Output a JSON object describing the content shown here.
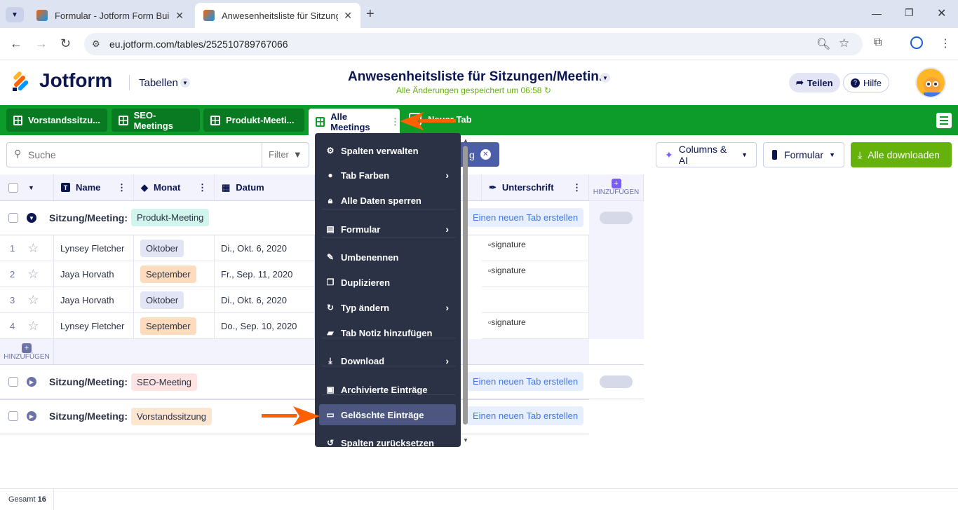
{
  "browser": {
    "tabs": [
      {
        "title": "Formular - Jotform Form Builde",
        "active": false
      },
      {
        "title": "Anwesenheitsliste für Sitzungen",
        "active": true
      }
    ],
    "url": "eu.jotform.com/tables/252510789767066"
  },
  "app": {
    "logo": "Jotform",
    "section": "Tabellen",
    "title": "Anwesenheitsliste für Sitzungen/Meetin...",
    "save_status": "Alle Änderungen gespeichert um 06:58",
    "share_label": "Teilen",
    "help_label": "Hilfe"
  },
  "sheet_tabs": [
    {
      "label": "Vorstandssitzu..."
    },
    {
      "label": "SEO-Meetings"
    },
    {
      "label": "Produkt-Meeti..."
    },
    {
      "label": "Alle Meetings",
      "active": true
    },
    {
      "label": "Neuer Tab"
    }
  ],
  "toolbar": {
    "search_placeholder": "Suche",
    "filter_label": "Filter",
    "chip_label": "g",
    "columns_ai_label": "Columns & AI",
    "form_label": "Formular",
    "download_label": "Alle downloaden"
  },
  "columns": {
    "name": "Name",
    "month": "Monat",
    "date": "Datum",
    "signature": "Unterschrift",
    "add": "HINZUFÜGEN"
  },
  "groups": [
    {
      "label": "Sitzung/Meeting:",
      "tag": "Produkt-Meeting",
      "new_tab": "Einen neuen Tab erstellen"
    },
    {
      "label": "Sitzung/Meeting:",
      "tag": "SEO-Meeting",
      "new_tab": "Einen neuen Tab erstellen"
    },
    {
      "label": "Sitzung/Meeting:",
      "tag": "Vorstandssitzung",
      "new_tab": "Einen neuen Tab erstellen"
    }
  ],
  "rows": [
    {
      "num": "1",
      "name": "Lynsey Fletcher",
      "month": "Oktober",
      "date": "Di., Okt. 6, 2020",
      "signature": "signature"
    },
    {
      "num": "2",
      "name": "Jaya Horvath",
      "month": "September",
      "date": "Fr., Sep. 11, 2020",
      "signature": "signature"
    },
    {
      "num": "3",
      "name": "Jaya Horvath",
      "month": "Oktober",
      "date": "Di., Okt. 6, 2020",
      "signature": ""
    },
    {
      "num": "4",
      "name": "Lynsey Fletcher",
      "month": "September",
      "date": "Do., Sep. 10, 2020",
      "signature": "signature"
    }
  ],
  "add_row_label": "HINZUFÜGEN",
  "menu": {
    "items": [
      {
        "label": "Spalten verwalten",
        "icon": "gear-icon"
      },
      {
        "label": "Tab Farben",
        "icon": "drop-icon",
        "submenu": true
      },
      {
        "label": "Alle Daten sperren",
        "icon": "lock-icon"
      },
      {
        "label": "Formular",
        "icon": "form-icon",
        "submenu": true
      },
      {
        "label": "Umbenennen",
        "icon": "edit-icon"
      },
      {
        "label": "Duplizieren",
        "icon": "copy-icon"
      },
      {
        "label": "Typ ändern",
        "icon": "refresh-icon",
        "submenu": true
      },
      {
        "label": "Tab Notiz hinzufügen",
        "icon": "note-icon"
      },
      {
        "label": "Download",
        "icon": "download-icon",
        "submenu": true
      },
      {
        "label": "Archivierte Einträge",
        "icon": "archive-icon"
      },
      {
        "label": "Gelöschte Einträge",
        "icon": "trash-box-icon",
        "highlighted": true
      },
      {
        "label": "Spalten zurücksetzen",
        "icon": "reset-icon"
      }
    ]
  },
  "footer": {
    "total_label": "Gesamt",
    "total_value": "16"
  },
  "colors": {
    "green": "#0d9b2a",
    "menu_bg": "#2b3245",
    "orange_arrow": "#ff6100",
    "download_btn": "#64b20a",
    "month_oktober": "#e3e5f5",
    "month_september": "#fddcbd",
    "tag_produkt": "#d1f5ec",
    "tag_seo": "#fde3e2",
    "tag_vorstand": "#fde6cf"
  }
}
